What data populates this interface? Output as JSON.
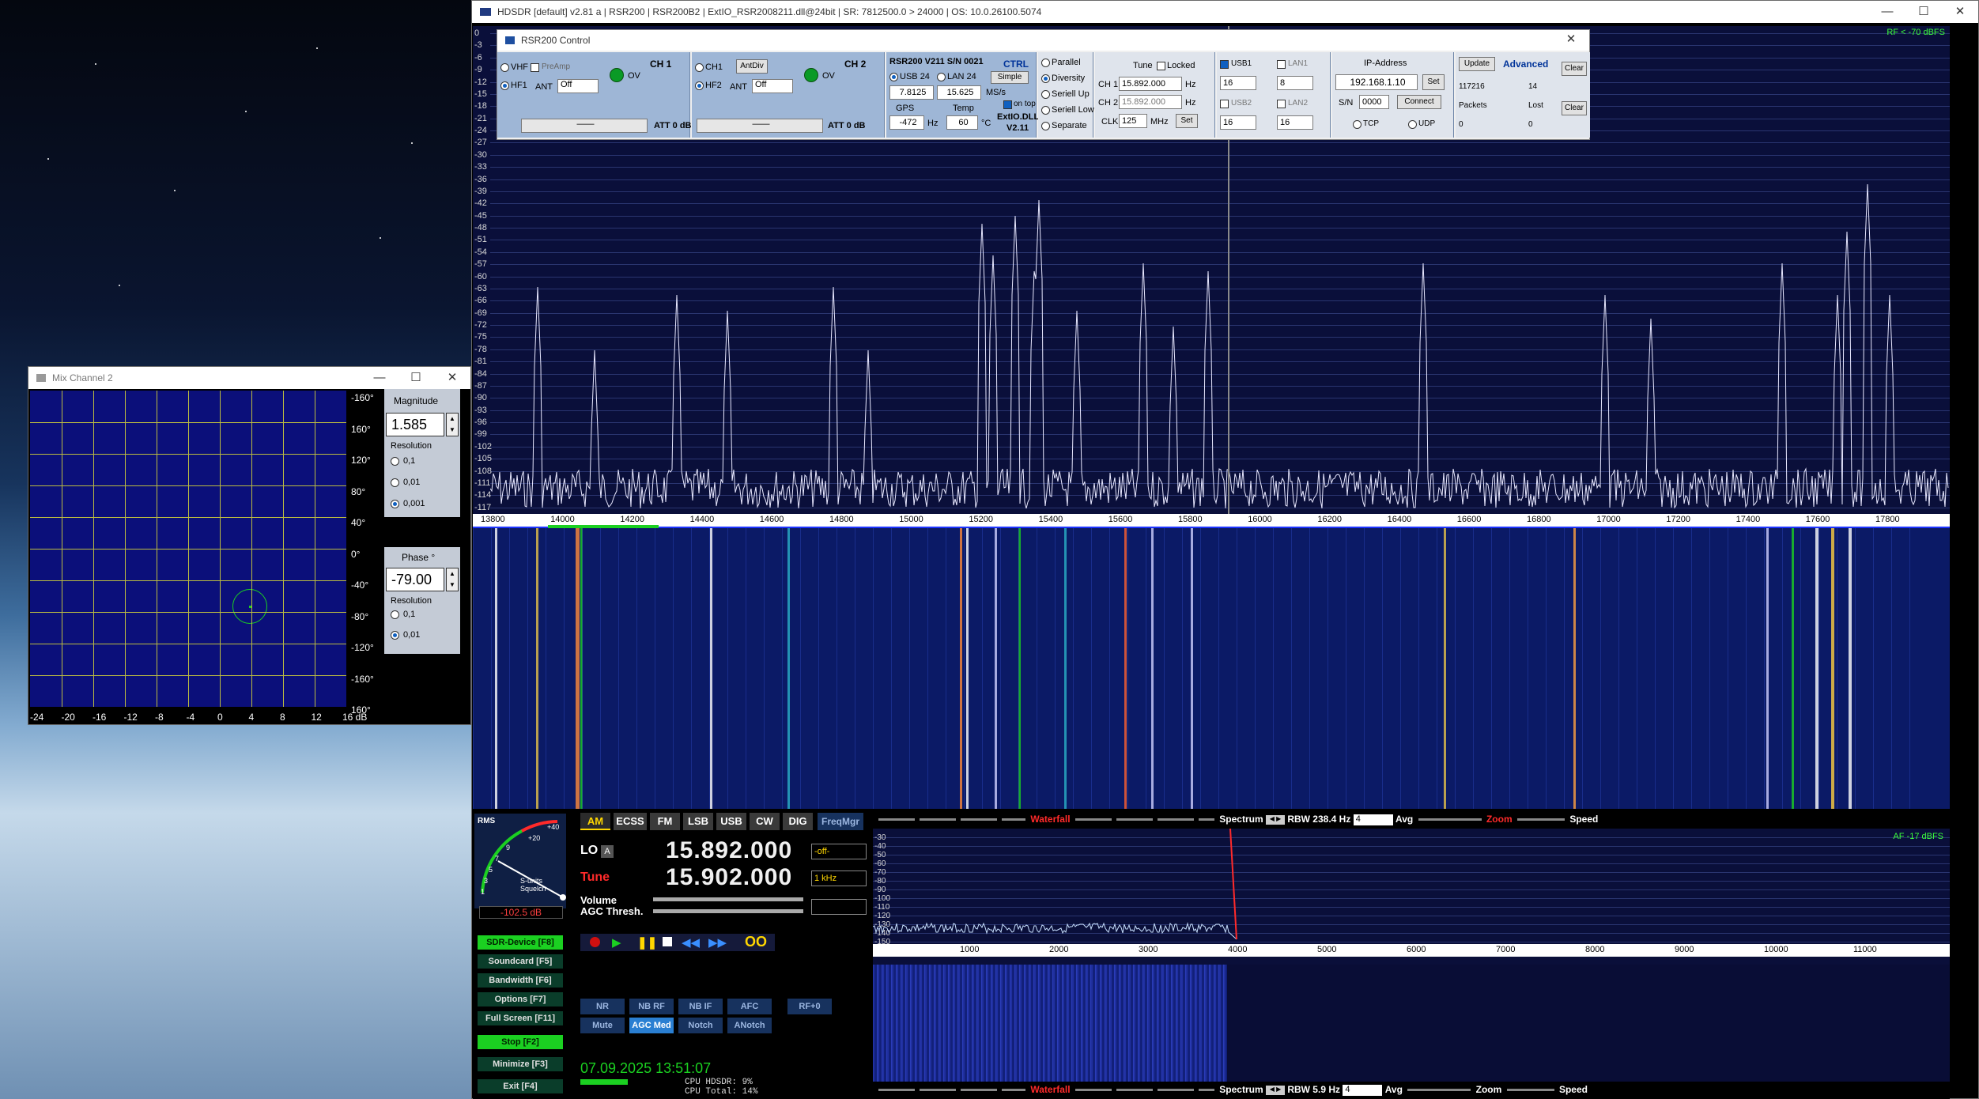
{
  "hdsdr": {
    "title": "HDSDR  [default]  v2.81 a  |  RSR200 | RSR200B2 | ExtIO_RSR2008211.dll@24bit  |  SR: 7812500.0 > 24000  |  OS: 10.0.26100.5074",
    "rf_level": "RF < -70 dBFS",
    "af_level": "AF -17 dBFS",
    "spectrum_y_ticks": [
      "0",
      "-3",
      "-6",
      "-9",
      "-12",
      "-15",
      "-18",
      "-21",
      "-24",
      "-27",
      "-30",
      "-33",
      "-36",
      "-39",
      "-42",
      "-45",
      "-48",
      "-51",
      "-54",
      "-57",
      "-60",
      "-63",
      "-66",
      "-69",
      "-72",
      "-75",
      "-78",
      "-81",
      "-84",
      "-87",
      "-90",
      "-93",
      "-96",
      "-99",
      "-102",
      "-105",
      "-108",
      "-111",
      "-114",
      "-117"
    ],
    "freq_axis": [
      "13800",
      "14000",
      "14200",
      "14400",
      "14600",
      "14800",
      "15000",
      "15200",
      "15400",
      "15600",
      "15800",
      "16000",
      "16200",
      "16400",
      "16600",
      "16800",
      "17000",
      "17200",
      "17400",
      "17600",
      "17800"
    ],
    "af_y_ticks": [
      "-30",
      "-40",
      "-50",
      "-60",
      "-70",
      "-80",
      "-90",
      "-100",
      "-110",
      "-120",
      "-130",
      "-140",
      "-150"
    ],
    "af_axis": [
      "1000",
      "2000",
      "3000",
      "4000",
      "5000",
      "6000",
      "7000",
      "8000",
      "9000",
      "10000",
      "11000"
    ]
  },
  "rsr": {
    "title": "RSR200 Control",
    "ch1": {
      "vhf": "VHF",
      "hf": "HF1",
      "preamp": "PreAmp",
      "ant_label": "ANT",
      "ant_value": "Off",
      "title": "CH 1",
      "ov": "OV",
      "att_label": "ATT",
      "att_value": "0",
      "att_unit": "dB",
      "slider": "——"
    },
    "ch2": {
      "ch1": "CH1",
      "antdiv": "AntDiv",
      "hf": "HF2",
      "ant_label": "ANT",
      "ant_value": "Off",
      "title": "CH 2",
      "ov": "OV",
      "att_label": "ATT",
      "att_value": "0",
      "att_unit": "dB",
      "slider": "——"
    },
    "info": {
      "title": "RSR200 V211  S/N 0021",
      "ctrl": "CTRL",
      "usb": "USB",
      "usb_n": "24",
      "lan": "LAN",
      "lan_n": "24",
      "simple": "Simple",
      "rate1": "7.8125",
      "rate2": "15.625",
      "msps": "MS/s",
      "ontop": "on top",
      "gps": "GPS",
      "temp": "Temp",
      "gps_value": "-472",
      "hz": "Hz",
      "temp_value": "60",
      "celsius": "°C",
      "extio": "ExtIO.DLL",
      "ver": "V2.11"
    },
    "mode": {
      "parallel": "Parallel",
      "diversity": "Diversity",
      "seriell_up": "Seriell Up",
      "seriell_low": "Seriell Low",
      "separate": "Separate"
    },
    "tune": {
      "label": "Tune",
      "locked": "Locked",
      "ch1": "CH 1",
      "ch1_value": "15.892.000",
      "ch2": "CH 2",
      "ch2_value": "15.892.000",
      "hz": "Hz",
      "clk": "CLK",
      "clk_value": "125",
      "mhz": "MHz",
      "set": "Set"
    },
    "usb": {
      "usb1": "USB1",
      "usb1_val": "16",
      "usb2": "USB2",
      "usb2_val": "16",
      "lan1": "LAN1",
      "lan1_val": "8",
      "lan2": "LAN2",
      "lan2_val": "16"
    },
    "ip": {
      "label": "IP-Address",
      "value": "192.168.1.10",
      "set": "Set",
      "sn": "S/N",
      "sn_value": "0000",
      "connect": "Connect",
      "tcp": "TCP",
      "udp": "UDP"
    },
    "adv": {
      "update": "Update",
      "advanced": "Advanced",
      "clear": "Clear",
      "packets_value": "117216",
      "lost_value": "14",
      "packets": "Packets",
      "lost": "Lost",
      "packets2": "0",
      "lost2": "0"
    }
  },
  "mix": {
    "title": "Mix Channel 2",
    "right_ticks": [
      "-160°",
      "160°",
      "120°",
      "80°",
      "40°",
      "0°",
      "-40°",
      "-80°",
      "-120°",
      "-160°",
      "160°"
    ],
    "bottom_ticks": [
      "-24",
      "-20",
      "-16",
      "-12",
      "-8",
      "-4",
      "0",
      "4",
      "8",
      "12",
      "16 dB"
    ],
    "magnitude_label": "Magnitude",
    "magnitude_value": "1.585",
    "resolution": "Resolution",
    "mag_res": [
      "0,1",
      "0,01",
      "0,001"
    ],
    "phase_label": "Phase °",
    "phase_value": "-79.00",
    "phase_res": [
      "0,1",
      "0,01"
    ]
  },
  "ctrl": {
    "rms": "RMS",
    "s_units": "S-units",
    "squelch": "Squelch",
    "level": "-102.5 dB",
    "meter_ticks": [
      "+40",
      "+20",
      "9",
      "7",
      "5",
      "3",
      "1"
    ],
    "modes": [
      "AM",
      "ECSS",
      "FM",
      "LSB",
      "USB",
      "CW",
      "DIG"
    ],
    "freqmgr": "FreqMgr",
    "lo_label": "LO",
    "lo_a": "A",
    "lo_value": "15.892.000",
    "lo_opt": "-off-",
    "tune_label": "Tune",
    "tune_value": "15.902.000",
    "tune_step": "1 kHz",
    "volume": "Volume",
    "agc": "AGC Thresh.",
    "side_buttons": [
      "SDR-Device [F8]",
      "Soundcard [F5]",
      "Bandwidth [F6]",
      "Options [F7]",
      "Full Screen [F11]"
    ],
    "stop": "Stop [F2]",
    "minimize": "Minimize [F3]",
    "exit": "Exit [F4]",
    "dsp_row1": [
      "NR",
      "NB RF",
      "NB IF",
      "AFC",
      "RF+0"
    ],
    "dsp_row2": [
      "Mute",
      "AGC Med",
      "Notch",
      "ANotch"
    ],
    "datetime": "07.09.2025 13:51:07",
    "cpu1": "CPU HDSDR: 9%",
    "cpu2": "CPU Total: 14%"
  },
  "strip": {
    "waterfall": "Waterfall",
    "spectrum": "Spectrum",
    "rbw1": "RBW 238.4 Hz",
    "avg_val": "4",
    "avg": "Avg",
    "zoom": "Zoom",
    "speed": "Speed",
    "rbw2": "RBW  5.9 Hz"
  },
  "colors": {
    "waterfall_bg": "#0b1a66",
    "spectrum_bg": "#0a0f3a",
    "accent_red": "#ff2a2a",
    "green": "#1bd021"
  }
}
